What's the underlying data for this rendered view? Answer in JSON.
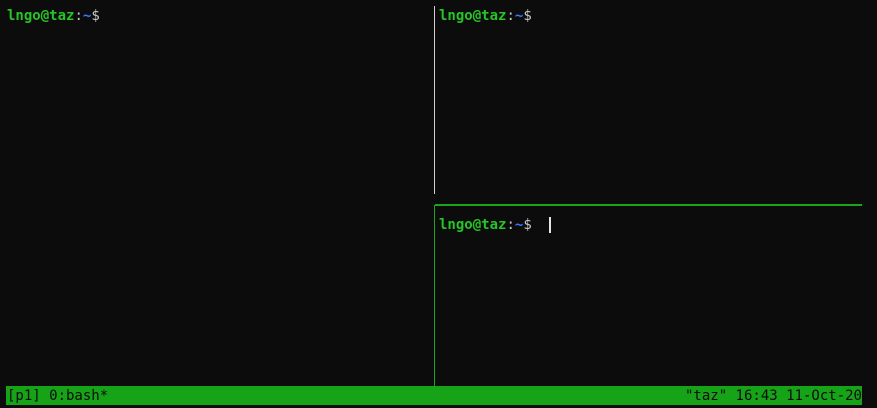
{
  "panes": [
    {
      "prompt": {
        "user": "lngo",
        "at": "@",
        "host": "taz",
        "colon": ":",
        "path": "~",
        "dollar": "$"
      }
    },
    {
      "prompt": {
        "user": "lngo",
        "at": "@",
        "host": "taz",
        "colon": ":",
        "path": "~",
        "dollar": "$"
      }
    },
    {
      "prompt": {
        "user": "lngo",
        "at": "@",
        "host": "taz",
        "colon": ":",
        "path": "~",
        "dollar": "$ "
      },
      "active": true
    }
  ],
  "status_bar": {
    "left": "[p1] 0:bash*",
    "right": "\"taz\" 16:43 11-Oct-20"
  },
  "colors": {
    "background": "#0c0c0c",
    "prompt_green": "#26c426",
    "path_blue": "#3b78ff",
    "status_green": "#17a317",
    "active_border": "#1aa51a"
  }
}
